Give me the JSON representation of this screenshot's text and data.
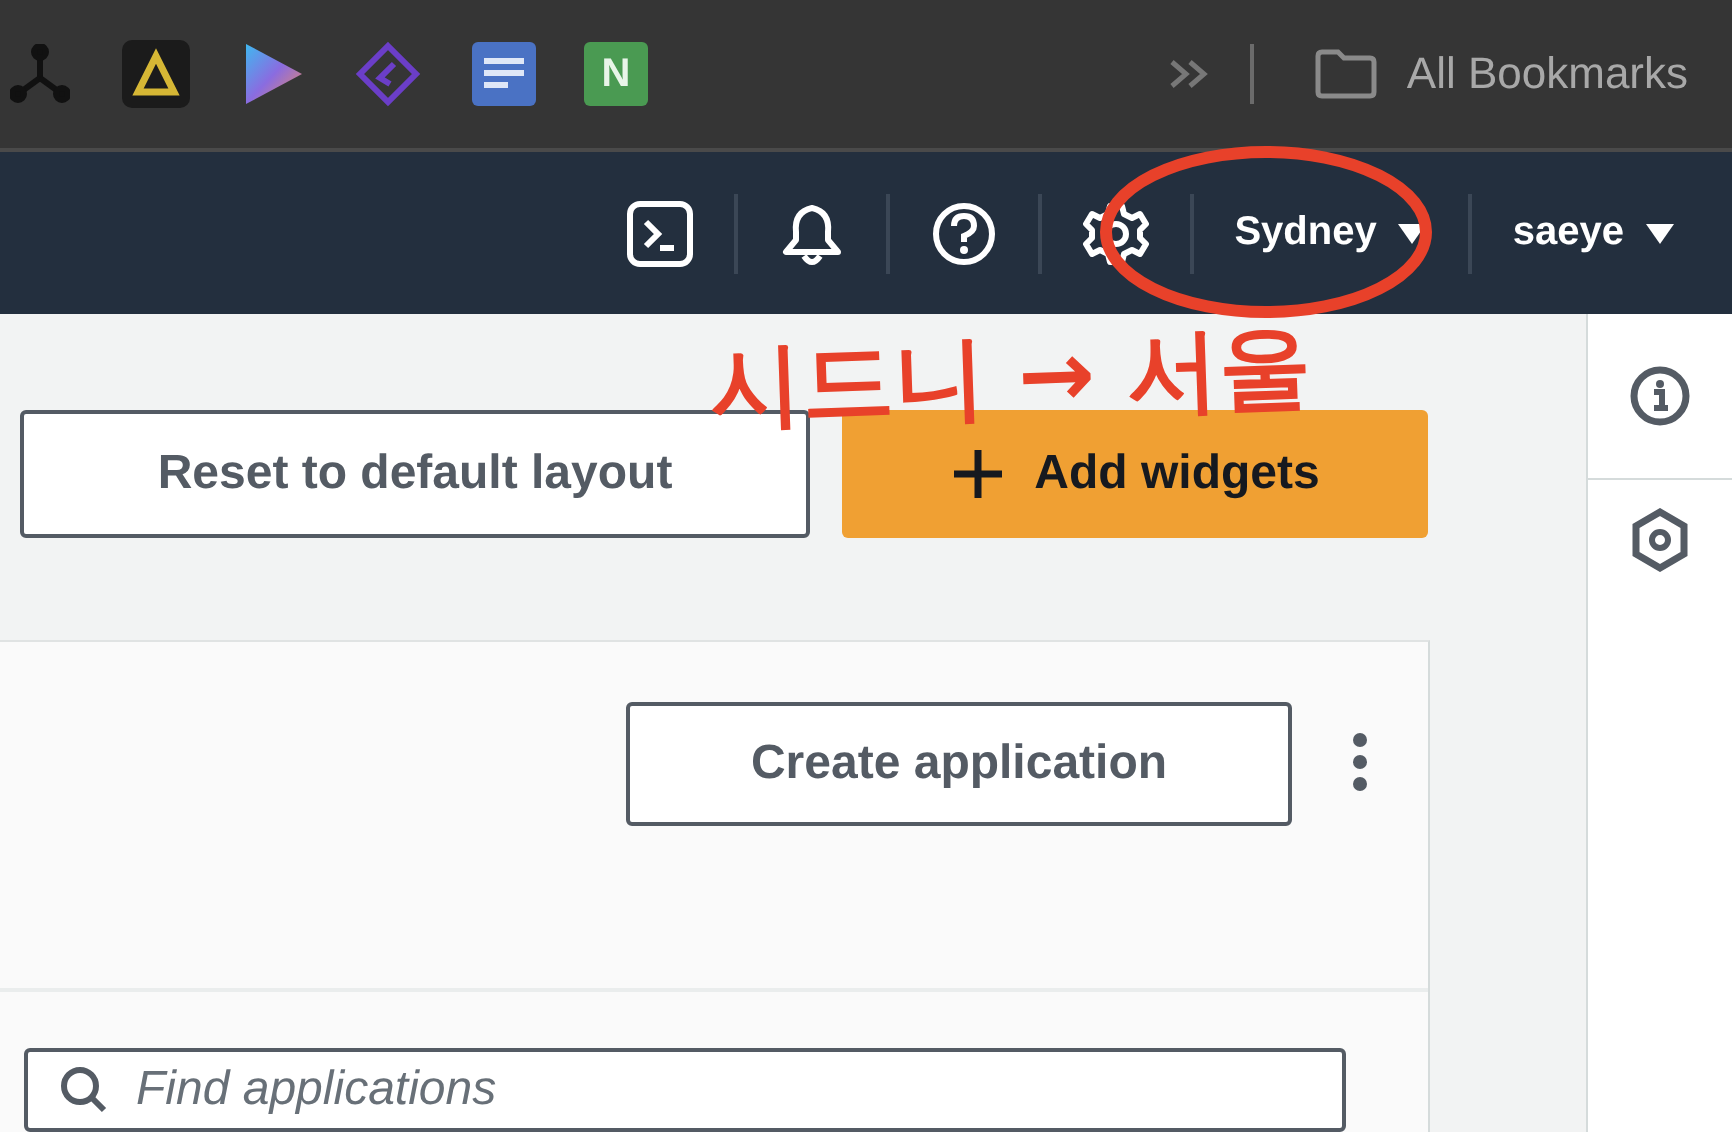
{
  "bookmarks_bar": {
    "badge_letter": "N",
    "all_bookmarks": "All Bookmarks"
  },
  "nav": {
    "region": "Sydney",
    "user": "saeye"
  },
  "toolbar": {
    "reset": "Reset to default layout",
    "add": "Add widgets"
  },
  "card": {
    "create": "Create application",
    "search_placeholder": "Find applications"
  },
  "annotation": {
    "text": "시드니 → 서울"
  }
}
